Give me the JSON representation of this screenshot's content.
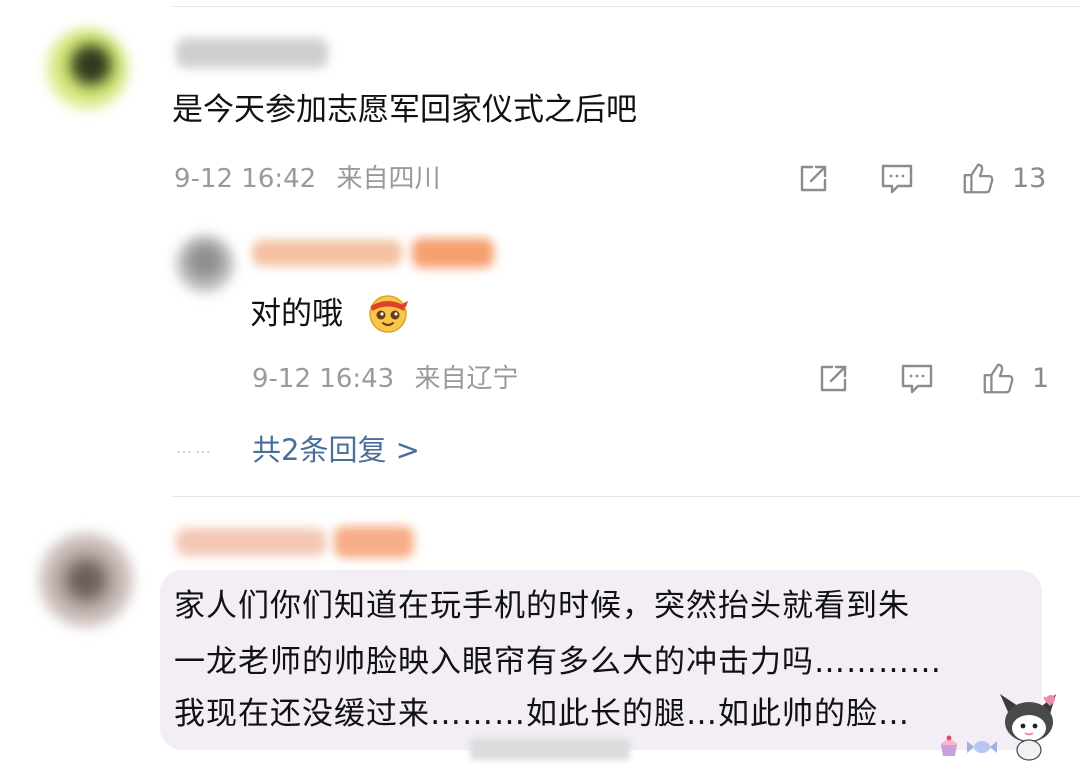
{
  "comments": [
    {
      "text": "是今天参加志愿军回家仪式之后吧",
      "date": "9-12 16:42",
      "location": "来自四川",
      "likes": "13"
    },
    {
      "text": "对的哦",
      "date": "9-12 16:43",
      "location": "来自辽宁",
      "likes": "1",
      "emoji": "headband-smile-emoji"
    }
  ],
  "more_replies": "共2条回复 >",
  "third_comment": {
    "lines": [
      "家人们你们知道在玩手机的时候，突然抬头就看到朱",
      "一龙老师的帅脸映入眼帘有多么大的冲击力吗…………",
      "我现在还没缓过来………如此长的腿…如此帅的脸…"
    ]
  },
  "icons": {
    "share": "share-icon",
    "comment": "comment-icon",
    "like": "thumbs-up-icon"
  },
  "colors": {
    "accent_link": "#4a6f9a",
    "bubble": "#f3eef6",
    "meta_gray": "#9a9a9a"
  }
}
